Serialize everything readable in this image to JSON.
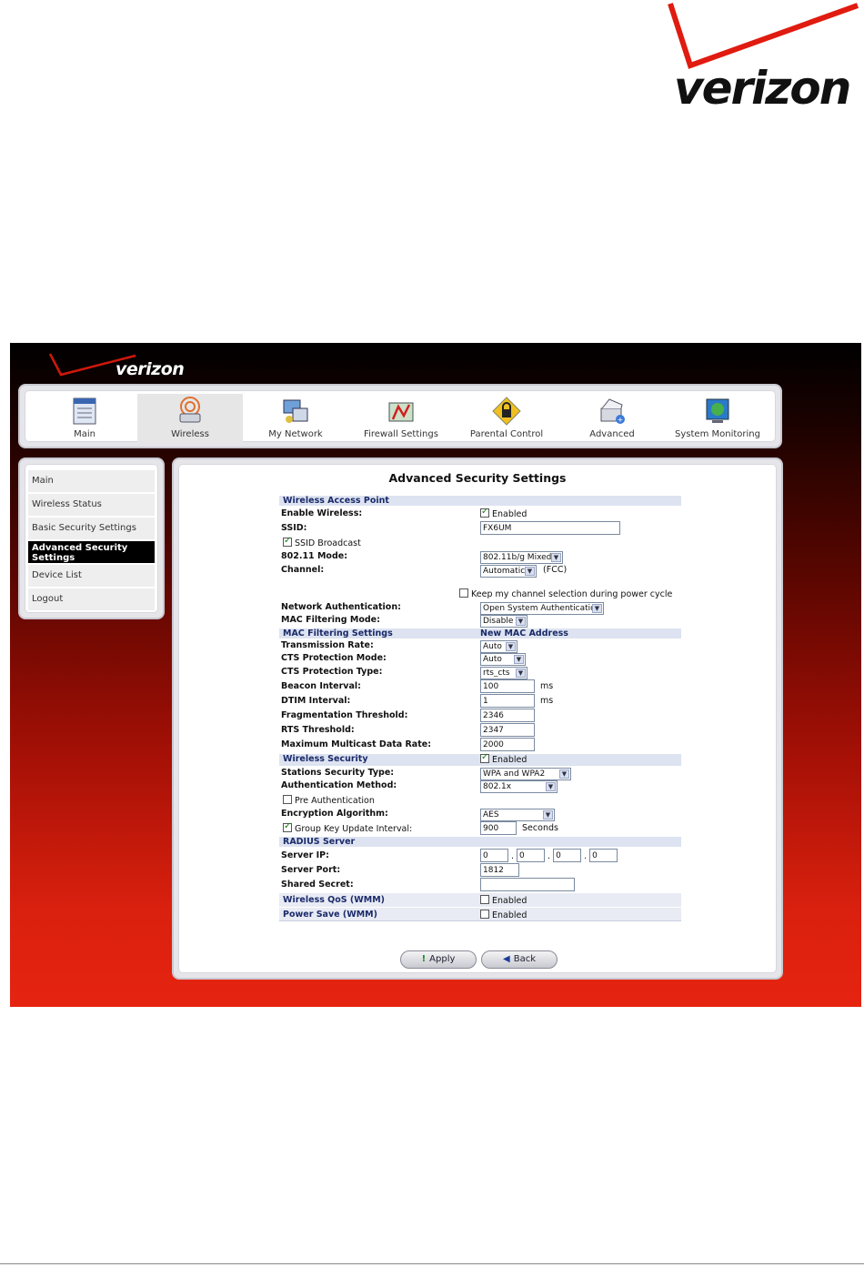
{
  "brand": {
    "name": "verizon"
  },
  "nav": {
    "items": [
      {
        "label": "Main",
        "icon": "main-icon"
      },
      {
        "label": "Wireless",
        "icon": "wireless-icon"
      },
      {
        "label": "My Network",
        "icon": "network-icon"
      },
      {
        "label": "Firewall Settings",
        "icon": "firewall-icon"
      },
      {
        "label": "Parental Control",
        "icon": "lock-icon"
      },
      {
        "label": "Advanced",
        "icon": "advanced-icon"
      },
      {
        "label": "System Monitoring",
        "icon": "monitor-icon"
      }
    ],
    "active": "Wireless"
  },
  "sidebar": {
    "items": [
      {
        "label": "Main"
      },
      {
        "label": "Wireless Status"
      },
      {
        "label": "Basic Security Settings"
      },
      {
        "label": "Advanced Security Settings"
      },
      {
        "label": "Device List"
      },
      {
        "label": "Logout"
      }
    ],
    "active": "Advanced Security Settings"
  },
  "page": {
    "title": "Advanced Security Settings"
  },
  "form": {
    "sec_wap": "Wireless Access Point",
    "enable_wireless": {
      "label": "Enable Wireless:",
      "value": "Enabled",
      "checked": true
    },
    "ssid": {
      "label": "SSID:",
      "value": "FX6UM"
    },
    "ssid_broadcast": {
      "label": "SSID Broadcast",
      "checked": true
    },
    "mode": {
      "label": "802.11 Mode:",
      "value": "802.11b/g Mixed"
    },
    "channel": {
      "label": "Channel:",
      "value": "Automatic",
      "note": "(FCC)"
    },
    "keep_channel": {
      "label": "Keep my channel selection during power cycle",
      "checked": false
    },
    "net_auth": {
      "label": "Network Authentication:",
      "value": "Open System Authentication"
    },
    "mac_mode": {
      "label": "MAC Filtering Mode:",
      "value": "Disable"
    },
    "sec_mac": "MAC Filtering Settings",
    "new_mac": "New MAC Address",
    "tx_rate": {
      "label": "Transmission Rate:",
      "value": "Auto"
    },
    "cts_mode": {
      "label": "CTS Protection Mode:",
      "value": "Auto"
    },
    "cts_type": {
      "label": "CTS Protection Type:",
      "value": "rts_cts"
    },
    "beacon": {
      "label": "Beacon Interval:",
      "value": "100",
      "unit": "ms"
    },
    "dtim": {
      "label": "DTIM Interval:",
      "value": "1",
      "unit": "ms"
    },
    "frag": {
      "label": "Fragmentation Threshold:",
      "value": "2346"
    },
    "rts": {
      "label": "RTS Threshold:",
      "value": "2347"
    },
    "multicast": {
      "label": "Maximum Multicast Data Rate:",
      "value": "2000"
    },
    "sec_ws": "Wireless Security",
    "ws_enabled": {
      "value": "Enabled",
      "checked": true
    },
    "sta_type": {
      "label": "Stations Security Type:",
      "value": "WPA and WPA2"
    },
    "auth_method": {
      "label": "Authentication Method:",
      "value": "802.1x"
    },
    "pre_auth": {
      "label": "Pre Authentication",
      "checked": false
    },
    "enc_alg": {
      "label": "Encryption Algorithm:",
      "value": "AES"
    },
    "group_key": {
      "label": "Group Key Update Interval:",
      "value": "900",
      "unit": "Seconds",
      "checked": true
    },
    "sec_radius": "RADIUS Server",
    "server_ip": {
      "label": "Server IP:",
      "octets": [
        "0",
        "0",
        "0",
        "0"
      ]
    },
    "server_port": {
      "label": "Server Port:",
      "value": "1812"
    },
    "shared_secret": {
      "label": "Shared Secret:",
      "value": ""
    },
    "qos": {
      "label": "Wireless QoS (WMM)",
      "value": "Enabled",
      "checked": false
    },
    "power_save": {
      "label": "Power Save (WMM)",
      "value": "Enabled",
      "checked": false
    }
  },
  "buttons": {
    "apply": "Apply",
    "back": "Back"
  }
}
